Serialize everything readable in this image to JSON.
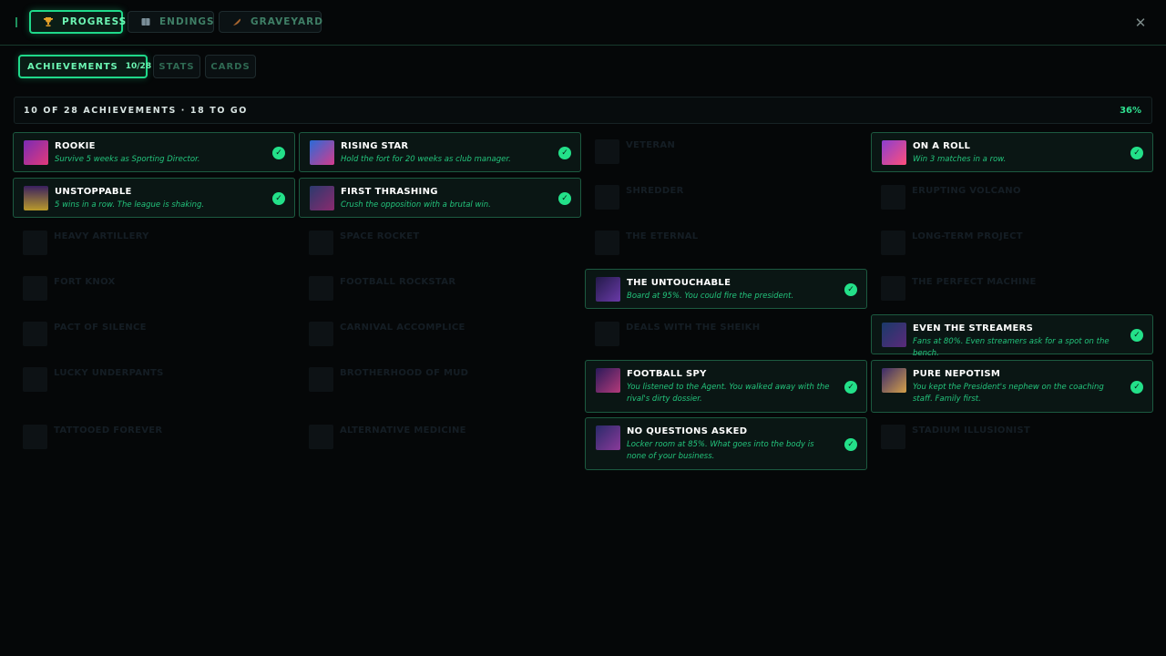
{
  "tabs": [
    {
      "label": "PROGRESS",
      "icon": "trophy-icon"
    },
    {
      "label": "ENDINGS",
      "icon": "book-icon"
    },
    {
      "label": "GRAVEYARD",
      "icon": "feather-icon"
    }
  ],
  "subtabs": [
    {
      "label": "ACHIEVEMENTS",
      "count": "10/28"
    },
    {
      "label": "STATS"
    },
    {
      "label": "CARDS"
    }
  ],
  "summary": {
    "text": "10 OF 28 ACHIEVEMENTS · 18 TO GO",
    "percent": "36%"
  },
  "achievements": [
    {
      "title": "ROOKIE",
      "desc": "Survive 5 weeks as Sporting Director.",
      "unlocked": true
    },
    {
      "title": "RISING STAR",
      "desc": "Hold the fort for 20 weeks as club manager.",
      "unlocked": true
    },
    {
      "title": "VETERAN",
      "desc": "",
      "unlocked": false
    },
    {
      "title": "ON A ROLL",
      "desc": "Win 3 matches in a row.",
      "unlocked": true
    },
    {
      "title": "UNSTOPPABLE",
      "desc": "5 wins in a row. The league is shaking.",
      "unlocked": true
    },
    {
      "title": "FIRST THRASHING",
      "desc": "Crush the opposition with a brutal win.",
      "unlocked": true
    },
    {
      "title": "SHREDDER",
      "desc": "",
      "unlocked": false
    },
    {
      "title": "ERUPTING VOLCANO",
      "desc": "",
      "unlocked": false
    },
    {
      "title": "HEAVY ARTILLERY",
      "desc": "",
      "unlocked": false
    },
    {
      "title": "SPACE ROCKET",
      "desc": "",
      "unlocked": false
    },
    {
      "title": "THE ETERNAL",
      "desc": "",
      "unlocked": false
    },
    {
      "title": "LONG-TERM PROJECT",
      "desc": "",
      "unlocked": false
    },
    {
      "title": "FORT KNOX",
      "desc": "",
      "unlocked": false
    },
    {
      "title": "FOOTBALL ROCKSTAR",
      "desc": "",
      "unlocked": false
    },
    {
      "title": "THE UNTOUCHABLE",
      "desc": "Board at 95%. You could fire the president.",
      "unlocked": true
    },
    {
      "title": "THE PERFECT MACHINE",
      "desc": "",
      "unlocked": false
    },
    {
      "title": "PACT OF SILENCE",
      "desc": "",
      "unlocked": false
    },
    {
      "title": "CARNIVAL ACCOMPLICE",
      "desc": "",
      "unlocked": false
    },
    {
      "title": "DEALS WITH THE SHEIKH",
      "desc": "",
      "unlocked": false
    },
    {
      "title": "EVEN THE STREAMERS",
      "desc": "Fans at 80%. Even streamers ask for a spot on the bench.",
      "unlocked": true
    },
    {
      "title": "LUCKY UNDERPANTS",
      "desc": "",
      "unlocked": false
    },
    {
      "title": "BROTHERHOOD OF MUD",
      "desc": "",
      "unlocked": false
    },
    {
      "title": "FOOTBALL SPY",
      "desc": "You listened to the Agent. You walked away with the rival's dirty dossier.",
      "unlocked": true
    },
    {
      "title": "PURE NEPOTISM",
      "desc": "You kept the President's nephew on the coaching staff. Family first.",
      "unlocked": true
    },
    {
      "title": "TATTOOED FOREVER",
      "desc": "",
      "unlocked": false
    },
    {
      "title": "ALTERNATIVE MEDICINE",
      "desc": "",
      "unlocked": false
    },
    {
      "title": "NO QUESTIONS ASKED",
      "desc": "Locker room at 85%. What goes into the body is none of your business.",
      "unlocked": true
    },
    {
      "title": "STADIUM ILLUSIONIST",
      "desc": "",
      "unlocked": false
    }
  ],
  "colors": {
    "accent": "#1fd98a",
    "check": "#23e089",
    "desc": "#23c47c",
    "background": "#050708"
  }
}
